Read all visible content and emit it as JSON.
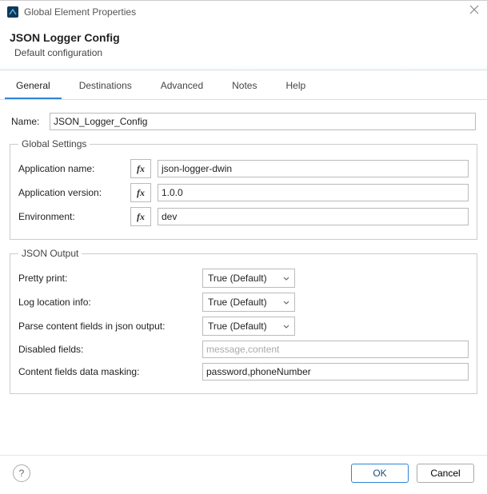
{
  "window": {
    "title": "Global Element Properties"
  },
  "header": {
    "title": "JSON Logger Config",
    "subtitle": "Default configuration"
  },
  "tabs": [
    {
      "label": "General",
      "active": true
    },
    {
      "label": "Destinations",
      "active": false
    },
    {
      "label": "Advanced",
      "active": false
    },
    {
      "label": "Notes",
      "active": false
    },
    {
      "label": "Help",
      "active": false
    }
  ],
  "nameField": {
    "label": "Name:",
    "value": "JSON_Logger_Config"
  },
  "globalSettings": {
    "legend": "Global Settings",
    "fxLabel": "fx",
    "applicationName": {
      "label": "Application name:",
      "value": "json-logger-dwin"
    },
    "applicationVersion": {
      "label": "Application version:",
      "value": "1.0.0"
    },
    "environment": {
      "label": "Environment:",
      "value": "dev"
    }
  },
  "jsonOutput": {
    "legend": "JSON Output",
    "prettyPrint": {
      "label": "Pretty print:",
      "value": "True (Default)"
    },
    "logLocation": {
      "label": "Log location info:",
      "value": "True (Default)"
    },
    "parseContent": {
      "label": "Parse content fields in json output:",
      "value": "True (Default)"
    },
    "disabledFields": {
      "label": "Disabled fields:",
      "placeholder": "message,content",
      "value": ""
    },
    "masking": {
      "label": "Content fields data masking:",
      "value": "password,phoneNumber"
    }
  },
  "buttons": {
    "ok": "OK",
    "cancel": "Cancel"
  }
}
